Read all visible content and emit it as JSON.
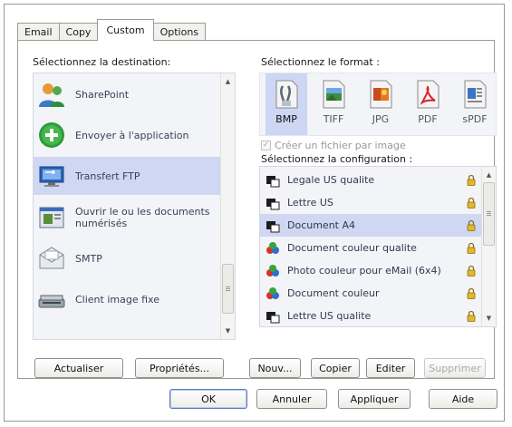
{
  "tabs": [
    {
      "label": "Email",
      "active": false
    },
    {
      "label": "Copy",
      "active": false
    },
    {
      "label": "Custom",
      "active": true
    },
    {
      "label": "Options",
      "active": false
    }
  ],
  "destination": {
    "title": "Sélectionnez la destination:",
    "items": [
      {
        "label": "SharePoint",
        "icon": "sharepoint-icon",
        "selected": false
      },
      {
        "label": "Envoyer à l'application",
        "icon": "send-to-application-icon",
        "selected": false
      },
      {
        "label": "Transfert FTP",
        "icon": "ftp-transfer-icon",
        "selected": true
      },
      {
        "label": "Ouvrir le ou les documents numérisés",
        "icon": "open-documents-icon",
        "selected": false
      },
      {
        "label": "SMTP",
        "icon": "smtp-icon",
        "selected": false
      },
      {
        "label": "Client image fixe",
        "icon": "still-image-client-icon",
        "selected": false
      }
    ]
  },
  "format": {
    "title": "Sélectionnez le format :",
    "items": [
      {
        "label": "BMP",
        "icon": "bmp-format-icon",
        "selected": true
      },
      {
        "label": "TIFF",
        "icon": "tiff-format-icon",
        "selected": false
      },
      {
        "label": "JPG",
        "icon": "jpg-format-icon",
        "selected": false
      },
      {
        "label": "PDF",
        "icon": "pdf-format-icon",
        "selected": false
      },
      {
        "label": "sPDF",
        "icon": "spdf-format-icon",
        "selected": false
      }
    ],
    "checkbox_label": "Créer un fichier par image",
    "checkbox_checked": true,
    "checkbox_disabled": true
  },
  "configuration": {
    "title": "Sélectionnez la configuration :",
    "items": [
      {
        "label": "Legale US qualite",
        "icon": "bw-document-icon",
        "selected": false
      },
      {
        "label": "Lettre US",
        "icon": "bw-document-icon",
        "selected": false
      },
      {
        "label": "Document A4",
        "icon": "bw-document-icon",
        "selected": true
      },
      {
        "label": "Document couleur qualite",
        "icon": "color-document-icon",
        "selected": false
      },
      {
        "label": "Photo couleur pour eMail (6x4)",
        "icon": "color-document-icon",
        "selected": false
      },
      {
        "label": "Document couleur",
        "icon": "color-document-icon",
        "selected": false
      },
      {
        "label": "Lettre US qualite",
        "icon": "bw-document-icon",
        "selected": false
      }
    ]
  },
  "panel_buttons": {
    "refresh": "Actualiser",
    "properties": "Propriétés...",
    "new": "Nouv...",
    "copy": "Copier",
    "edit": "Editer",
    "delete": "Supprimer"
  },
  "dialog_buttons": {
    "ok": "OK",
    "cancel": "Annuler",
    "apply": "Appliquer",
    "help": "Aide"
  },
  "colors": {
    "selection": "#cfd7f3",
    "list_background": "#f2f4f8",
    "lock": "#e0b92c"
  }
}
